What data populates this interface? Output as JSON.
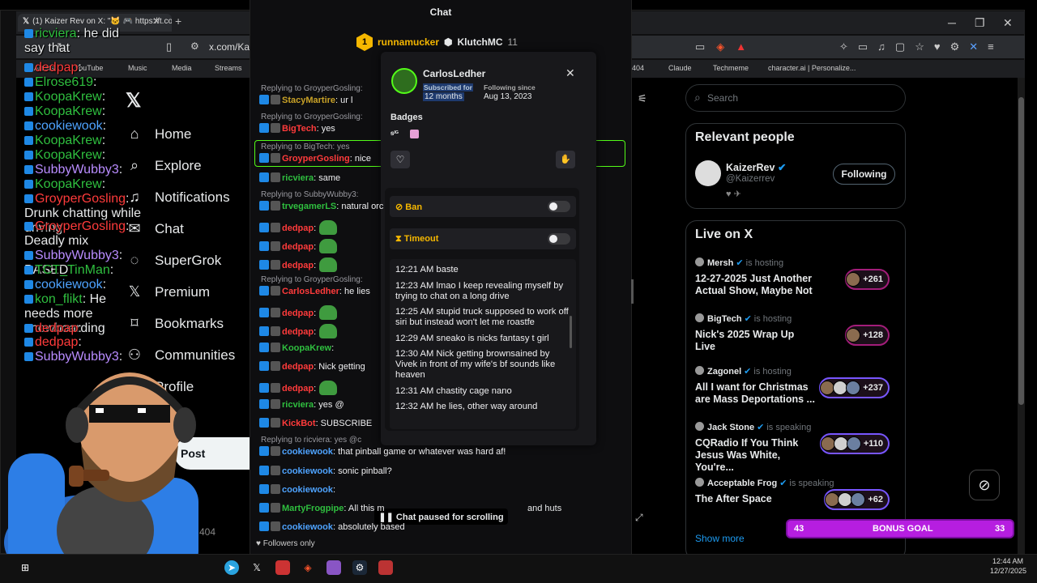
{
  "browser": {
    "tab_title": "(1) Kaizer Rev on X: \"🐱 🎮 https://t.co/",
    "address": "x.com/Kaiz",
    "bookmarks": [
      "Artists",
      "YouTube",
      "Music",
      "Media",
      "Streams",
      "404",
      "Claude",
      "Techmeme",
      "character.ai | Personalize..."
    ]
  },
  "stream_chat": [
    {
      "user": "ricviera",
      "text": ": he did say that",
      "color": "#2fbf3f"
    },
    {
      "user": "dedpap",
      "text": ":",
      "color": "#ff3b3b"
    },
    {
      "user": "Elrose619",
      "text": ":",
      "color": "#2fbf3f"
    },
    {
      "user": "KoopaKrew",
      "text": ":",
      "color": "#2fbf3f"
    },
    {
      "user": "KoopaKrew",
      "text": ":",
      "color": "#2fbf3f"
    },
    {
      "user": "cookiewook",
      "text": ":",
      "color": "#4ea3ff"
    },
    {
      "user": "KoopaKrew",
      "text": ":",
      "color": "#2fbf3f"
    },
    {
      "user": "KoopaKrew",
      "text": ":",
      "color": "#2fbf3f"
    },
    {
      "user": "SubbyWubby3",
      "text": ":",
      "color": "#b98cff"
    },
    {
      "user": "KoopaKrew",
      "text": ":",
      "color": "#2fbf3f"
    },
    {
      "user": "GroyperGosling",
      "text": ": Drunk chatting while driving",
      "color": "#ff3b3b"
    },
    {
      "user": "GroyperGosling",
      "text": ": Deadly mix",
      "color": "#ff3b3b"
    },
    {
      "user": "SubbyWubby3",
      "text": ": BASED",
      "color": "#b98cff"
    },
    {
      "user": "TCT_TinMan",
      "text": ":",
      "color": "#2fbf3f"
    },
    {
      "user": "cookiewook",
      "text": ":",
      "color": "#4ea3ff"
    },
    {
      "user": "kon_flikt",
      "text": ": He needs more snowboarding",
      "color": "#2fbf3f"
    },
    {
      "user": "dedpap",
      "text": ":",
      "color": "#ff3b3b"
    },
    {
      "user": "dedpap",
      "text": ":",
      "color": "#ff3b3b"
    },
    {
      "user": "SubbyWubby3",
      "text": ":",
      "color": "#b98cff"
    }
  ],
  "nav": {
    "home": "Home",
    "explore": "Explore",
    "notifications": "Notifications",
    "chat": "Chat",
    "supergrok": "SuperGrok",
    "premium": "Premium",
    "bookmarks": "Bookmarks",
    "communities": "Communities",
    "profile": "Profile",
    "post": "Post"
  },
  "chat": {
    "header": "Chat",
    "gift_leader": "runnamucker",
    "gift_user": "KlutchMC",
    "gift_count": "11",
    "gift_rank": "1",
    "paused": "Chat paused for scrolling",
    "followers_only": "Followers only",
    "messages": [
      {
        "reply": "Replying to GroyperGosling:",
        "user": "StacyMartire",
        "text": ": ur l",
        "color": "#c9a227"
      },
      {
        "reply": "Replying to GroyperGosling:",
        "user": "BigTech",
        "text": ": yes",
        "color": "#ff3b3b"
      },
      {
        "reply": "Replying to BigTech: yes",
        "user": "GroyperGosling",
        "text": ": nice",
        "color": "#ff3b3b"
      },
      {
        "reply": "",
        "user": "ricviera",
        "text": ": same",
        "color": "#2fbf3f"
      },
      {
        "reply": "Replying to SubbyWubby3:",
        "user": "trvegamerLS",
        "text": ": natural orc",
        "color": "#2fbf3f"
      },
      {
        "reply": "",
        "user": "dedpap",
        "text": ":",
        "color": "#ff3b3b"
      },
      {
        "reply": "",
        "user": "dedpap",
        "text": ":",
        "color": "#ff3b3b"
      },
      {
        "reply": "",
        "user": "dedpap",
        "text": ":",
        "color": "#ff3b3b"
      },
      {
        "reply": "Replying to GroyperGosling:",
        "user": "CarlosLedher",
        "text": ": he lies",
        "color": "#ff3b3b"
      },
      {
        "reply": "",
        "user": "dedpap",
        "text": ":",
        "color": "#ff3b3b"
      },
      {
        "reply": "",
        "user": "dedpap",
        "text": ":",
        "color": "#ff3b3b"
      },
      {
        "reply": "",
        "user": "KoopaKrew",
        "text": ":",
        "color": "#2fbf3f"
      },
      {
        "reply": "",
        "user": "dedpap",
        "text": ": Nick getting",
        "color": "#ff3b3b"
      },
      {
        "reply": "",
        "user": "dedpap",
        "text": ":",
        "color": "#ff3b3b"
      },
      {
        "reply": "",
        "user": "ricviera",
        "text": ": yes @",
        "color": "#2fbf3f"
      },
      {
        "reply": "",
        "user": "KickBot",
        "text": ": SUBSCRIBE",
        "color": "#ff3b3b"
      },
      {
        "reply": "Replying to ricviera: yes @c",
        "user": "cookiewook",
        "text": ": that pinball game or whatever was hard af!",
        "color": "#4ea3ff"
      },
      {
        "reply": "",
        "user": "cookiewook",
        "text": ": sonic pinball?",
        "color": "#4ea3ff"
      },
      {
        "reply": "",
        "user": "cookiewook",
        "text": ":",
        "color": "#4ea3ff"
      },
      {
        "reply": "",
        "user": "MartyFrogpipe",
        "text": ": All this m",
        "color": "#2fbf3f"
      },
      {
        "reply": "",
        "user": "cookiewook",
        "text": ": absolutely based",
        "color": "#4ea3ff"
      }
    ],
    "message_tail": "and huts"
  },
  "usercard": {
    "name": "CarlosLedher",
    "subscribed_label": "Subscribed for",
    "subscribed_value": "12 months",
    "following_label": "Following since",
    "following_value": "Aug 13, 2023",
    "badges_label": "Badges",
    "ban_label": "Ban",
    "timeout_label": "Timeout",
    "log": [
      {
        "time": "12:21 AM",
        "text": "baste"
      },
      {
        "time": "12:23 AM",
        "text": "lmao I keep revealing myself by trying to chat on a long drive"
      },
      {
        "time": "12:25 AM",
        "text": "stupid truck supposed to work off siri but instead won't let me roastfe"
      },
      {
        "time": "12:29 AM",
        "text": "sneako is nicks fantasy t girl"
      },
      {
        "time": "12:30 AM",
        "text": "Nick getting brownsained by Vivek in front of my wife's bf sounds like heaven"
      },
      {
        "time": "12:31 AM",
        "text": "chastity cage nano"
      },
      {
        "time": "12:32 AM",
        "text": "he lies, other way around"
      }
    ]
  },
  "right": {
    "search_placeholder": "Search",
    "relevant_title": "Relevant people",
    "relevant_name": "KaizerRev",
    "relevant_handle": "@Kaizerrev",
    "following_btn": "Following",
    "live_title": "Live on X",
    "show_more": "Show more",
    "live": [
      {
        "host": "Mersh",
        "status": "is hosting",
        "title": "12-27-2025 Just Another Actual Show, Maybe Not",
        "count": "+261"
      },
      {
        "host": "BigTech",
        "status": "is hosting",
        "title": "Nick's 2025 Wrap Up Live",
        "count": "+128"
      },
      {
        "host": "Zagonel",
        "status": "is hosting",
        "title": "All I want for Christmas are Mass Deportations ...",
        "count": "+237"
      },
      {
        "host": "Jack Stone",
        "status": "is speaking",
        "title": "CQRadio If You Think Jesus Was White, You're...",
        "count": "+110"
      },
      {
        "host": "Acceptable Frog",
        "status": "is speaking",
        "title": "The After Space",
        "count": "+62"
      }
    ]
  },
  "bonus": {
    "left": "43",
    "label": "BONUS GOAL",
    "right": "33"
  },
  "page_404": "404",
  "taskbar": {
    "time": "12:44 AM",
    "date": "12/27/2025"
  },
  "colors": {
    "accent_green": "#53fc18",
    "x_blue": "#1d9bf0",
    "bonus_purple": "#b61ee0"
  }
}
